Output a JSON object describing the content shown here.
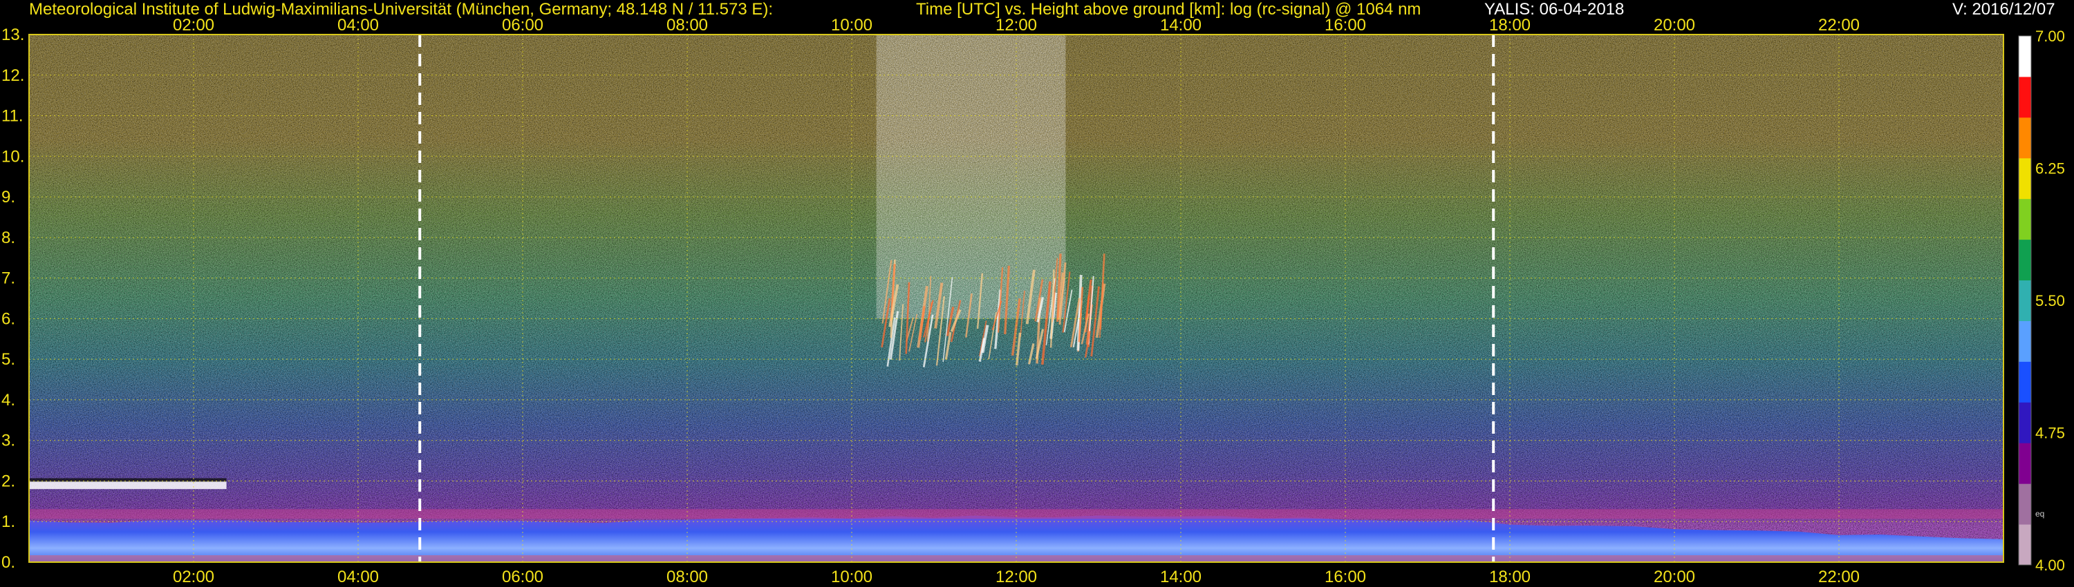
{
  "header": {
    "institute": "Meteorological Institute of Ludwig-Maximilians-Universität (München, Germany; 48.148 N / 11.573 E):",
    "axes_description": "Time [UTC] vs. Height above ground [km]: log (rc-signal) @ 1064 nm",
    "instrument_date": "YALIS: 06-04-2018",
    "version": "V: 2016/12/07"
  },
  "chart_data": {
    "type": "heatmap",
    "title": "Time [UTC] vs. Height above ground [km]: log (rc-signal) @ 1064 nm",
    "xlabel": "Time [UTC]",
    "ylabel": "Height above ground [km]",
    "xlim": [
      0,
      24
    ],
    "ylim": [
      0,
      13
    ],
    "x_ticks": [
      {
        "value": 2,
        "label": "02:00"
      },
      {
        "value": 4,
        "label": "04:00"
      },
      {
        "value": 6,
        "label": "06:00"
      },
      {
        "value": 8,
        "label": "08:00"
      },
      {
        "value": 10,
        "label": "10:00"
      },
      {
        "value": 12,
        "label": "12:00"
      },
      {
        "value": 14,
        "label": "14:00"
      },
      {
        "value": 16,
        "label": "16:00"
      },
      {
        "value": 18,
        "label": "18:00"
      },
      {
        "value": 20,
        "label": "20:00"
      },
      {
        "value": 22,
        "label": "22:00"
      }
    ],
    "y_ticks": [
      {
        "value": 0,
        "label": "0."
      },
      {
        "value": 1,
        "label": "1."
      },
      {
        "value": 2,
        "label": "2."
      },
      {
        "value": 3,
        "label": "3."
      },
      {
        "value": 4,
        "label": "4."
      },
      {
        "value": 5,
        "label": "5."
      },
      {
        "value": 6,
        "label": "6."
      },
      {
        "value": 7,
        "label": "7."
      },
      {
        "value": 8,
        "label": "8."
      },
      {
        "value": 9,
        "label": "9."
      },
      {
        "value": 10,
        "label": "10."
      },
      {
        "value": 11,
        "label": "11."
      },
      {
        "value": 12,
        "label": "12."
      },
      {
        "value": 13,
        "label": "13."
      }
    ],
    "grid": true,
    "marker_times": [
      4.75,
      17.8
    ],
    "colorbar": {
      "range": [
        4.0,
        7.0
      ],
      "ticks": [
        {
          "value": 7.0,
          "label": "7.00"
        },
        {
          "value": 6.25,
          "label": "6.25"
        },
        {
          "value": 5.5,
          "label": "5.50"
        },
        {
          "value": 4.75,
          "label": "4.75"
        },
        {
          "value": 4.0,
          "label": "4.00"
        }
      ],
      "note": "eq",
      "colors": [
        "#c8a8c0",
        "#a070a0",
        "#800090",
        "#3018c0",
        "#1a50ff",
        "#5aa0ff",
        "#30b0b0",
        "#10a050",
        "#80d020",
        "#f0e000",
        "#ff8800",
        "#ff1010",
        "#ffffff"
      ]
    },
    "features": {
      "boundary_layer_height_km": 1.0,
      "cirrus_cloud": {
        "time_range": [
          10.3,
          13.2
        ],
        "height_range_km": [
          4.8,
          7.6
        ]
      },
      "low_cloud": {
        "time_range": [
          0.0,
          2.4
        ],
        "height_range_km": [
          1.8,
          2.0
        ]
      }
    }
  }
}
